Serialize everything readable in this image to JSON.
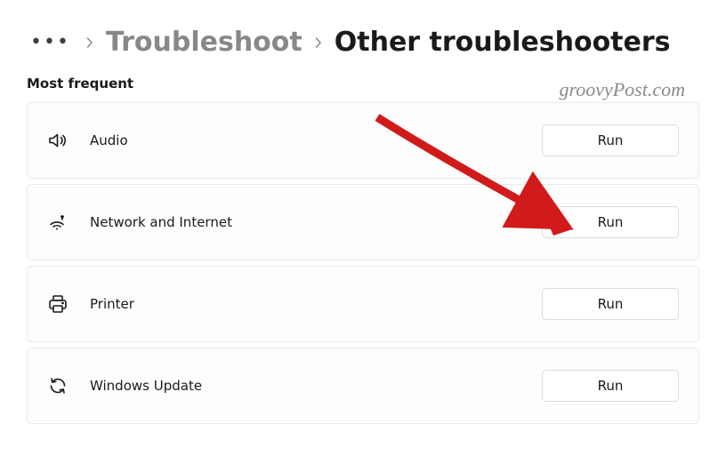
{
  "breadcrumb": {
    "ellipsis_aria": "More",
    "parent": "Troubleshoot",
    "current": "Other troubleshooters"
  },
  "section": {
    "heading": "Most frequent"
  },
  "watermark": "groovyPost.com",
  "items": [
    {
      "label": "Audio",
      "run_label": "Run",
      "icon": "speaker"
    },
    {
      "label": "Network and Internet",
      "run_label": "Run",
      "icon": "wifi"
    },
    {
      "label": "Printer",
      "run_label": "Run",
      "icon": "printer"
    },
    {
      "label": "Windows Update",
      "run_label": "Run",
      "icon": "sync"
    }
  ],
  "annotation": {
    "color": "#d11a1a",
    "target": 1
  }
}
